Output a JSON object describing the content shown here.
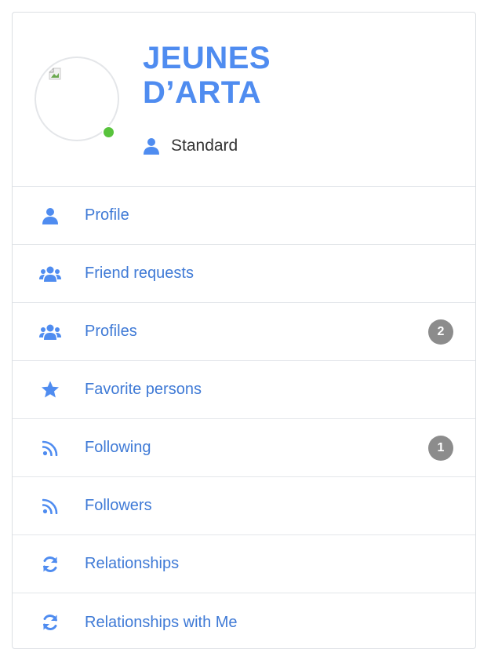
{
  "profile": {
    "name_line1": "JEUNES",
    "name_line2": "D’ARTA",
    "role": "Standard",
    "role_icon": "user-icon",
    "status": "online",
    "status_color": "#58c33c"
  },
  "colors": {
    "accent": "#4f8cf0",
    "link": "#3f7ad6",
    "badge": "#8c8c8c"
  },
  "menu": {
    "items": [
      {
        "label": "Profile",
        "icon": "user-icon"
      },
      {
        "label": "Friend requests",
        "icon": "users-icon"
      },
      {
        "label": "Profiles",
        "icon": "users-icon",
        "badge": "2"
      },
      {
        "label": "Favorite persons",
        "icon": "star-icon"
      },
      {
        "label": "Following",
        "icon": "rss-icon",
        "badge": "1"
      },
      {
        "label": "Followers",
        "icon": "rss-icon"
      },
      {
        "label": "Relationships",
        "icon": "sync-icon"
      },
      {
        "label": "Relationships with Me",
        "icon": "sync-icon"
      }
    ]
  }
}
